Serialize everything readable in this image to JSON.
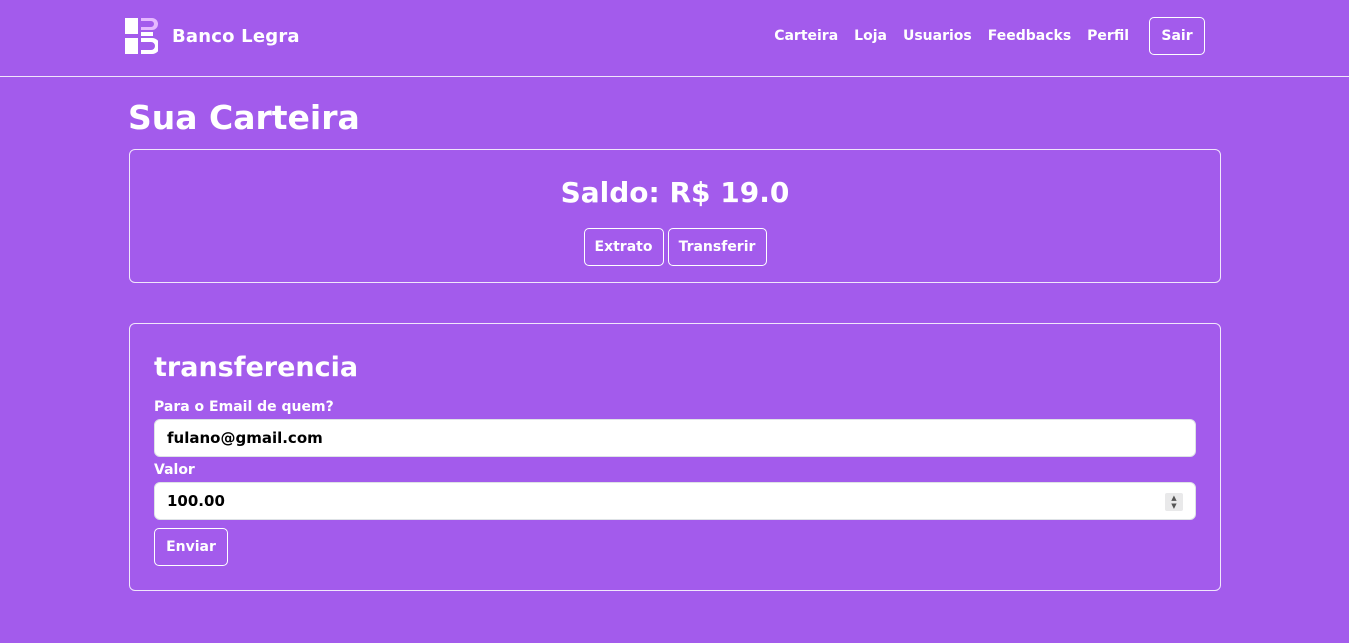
{
  "brand": {
    "name": "Banco Legra",
    "logo_icon": "banco-legra-logo-icon"
  },
  "nav": {
    "links": [
      "Carteira",
      "Loja",
      "Usuarios",
      "Feedbacks",
      "Perfil"
    ],
    "logout_label": "Sair"
  },
  "page": {
    "title": "Sua Carteira"
  },
  "wallet": {
    "balance_text": "Saldo: R$ 19.0",
    "statement_label": "Extrato",
    "transfer_label": "Transferir"
  },
  "transfer_form": {
    "title": "transferencia",
    "email_label": "Para o Email de quem?",
    "email_value": "fulano@gmail.com",
    "amount_label": "Valor",
    "amount_value": "100.00",
    "submit_label": "Enviar"
  },
  "colors": {
    "background": "#a35bec",
    "accent_logo": "#e5b8ff",
    "text": "#ffffff"
  }
}
